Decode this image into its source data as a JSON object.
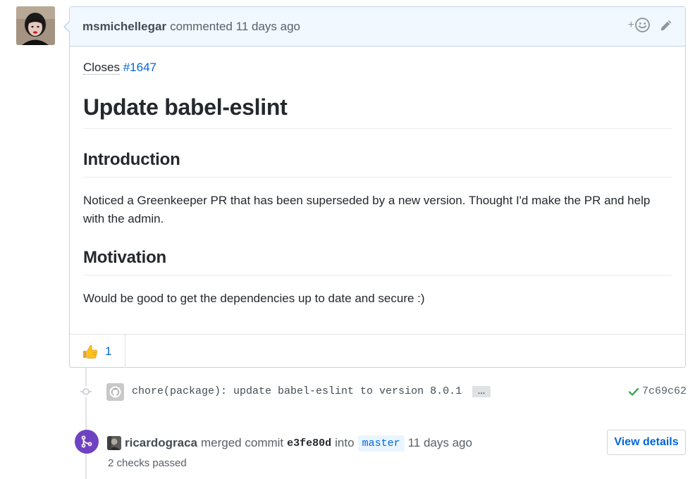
{
  "comment": {
    "author": "msmichellegar",
    "action": "commented",
    "time": "11 days ago",
    "reaction_add_label": "+",
    "closes_word": "Closes",
    "closes_ref": "#1647",
    "title": "Update babel-eslint",
    "sections": [
      {
        "heading": "Introduction",
        "text": "Noticed a Greenkeeper PR that has been superseded by a new version. Thought I'd make the PR and help with the admin."
      },
      {
        "heading": "Motivation",
        "text": "Would be good to get the dependencies up to date and secure :)"
      }
    ],
    "reactions": [
      {
        "emoji": "thumbs-up",
        "count": "1"
      }
    ]
  },
  "commit": {
    "message": "chore(package): update babel-eslint to version 8.0.1",
    "ellipsis": "…",
    "sha": "7c69c62",
    "status_color": "#28a745"
  },
  "merge": {
    "user": "ricardograca",
    "action": "merged commit",
    "sha": "e3fe80d",
    "into": "into",
    "branch": "master",
    "time": "11 days ago",
    "checks": "2 checks passed",
    "view_details": "View details",
    "badge_color": "#6f42c1"
  },
  "colors": {
    "link": "#0366d6",
    "header_bg": "#f1f8ff",
    "header_border": "#c0d3eb"
  }
}
